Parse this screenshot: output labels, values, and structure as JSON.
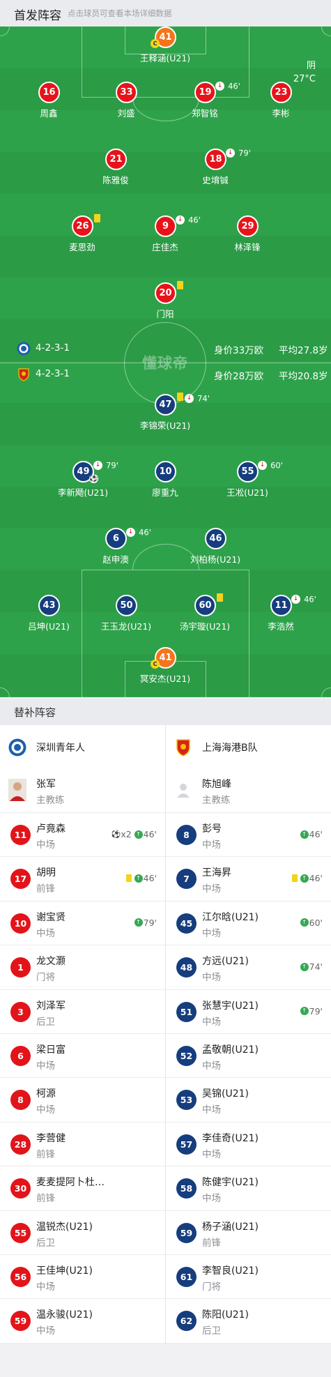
{
  "header": {
    "title": "首发阵容",
    "hint": "点击球员可查看本场详细数据"
  },
  "weather": {
    "condition": "阴",
    "temp": "27°C"
  },
  "watermark": "懂球帝",
  "home": {
    "formation": "4-2-3-1",
    "value": "身价33万欧",
    "avg_age": "平均27.8岁",
    "logo_icon": "shenzhen-youth-logo"
  },
  "away": {
    "formation": "4-2-3-1",
    "value": "身价28万欧",
    "avg_age": "平均20.8岁",
    "logo_icon": "shanghai-port-logo"
  },
  "home_players": [
    {
      "num": "41",
      "name": "王释涵(U21)",
      "captain": true
    },
    {
      "num": "16",
      "name": "周鑫"
    },
    {
      "num": "33",
      "name": "刘盛"
    },
    {
      "num": "19",
      "name": "郑智铭",
      "sub_min": "46'"
    },
    {
      "num": "23",
      "name": "李彬"
    },
    {
      "num": "21",
      "name": "陈雅俊"
    },
    {
      "num": "18",
      "name": "史堉铖",
      "sub_min": "79'"
    },
    {
      "num": "26",
      "name": "麦思劲",
      "yellow": true
    },
    {
      "num": "9",
      "name": "庄佳杰",
      "sub_min": "46'"
    },
    {
      "num": "29",
      "name": "林泽锋"
    },
    {
      "num": "20",
      "name": "门阳",
      "yellow": true
    }
  ],
  "away_players": [
    {
      "num": "47",
      "name": "李锦荣(U21)",
      "yellow": true,
      "sub_min": "74'"
    },
    {
      "num": "49",
      "name": "李新飏(U21)",
      "sub_min": "79'",
      "goal": true
    },
    {
      "num": "10",
      "name": "廖重九"
    },
    {
      "num": "55",
      "name": "王凇(U21)",
      "sub_min": "60'"
    },
    {
      "num": "6",
      "name": "赵申澳",
      "sub_min": "46'"
    },
    {
      "num": "46",
      "name": "刘柏杨(U21)"
    },
    {
      "num": "43",
      "name": "吕坤(U21)"
    },
    {
      "num": "50",
      "name": "王玉龙(U21)"
    },
    {
      "num": "60",
      "name": "汤宇璇(U21)",
      "yellow": true
    },
    {
      "num": "11",
      "name": "李浩然",
      "sub_min": "46'"
    },
    {
      "num": "41",
      "name": "冥安杰(U21)",
      "captain": true
    }
  ],
  "subs": {
    "title": "替补阵容",
    "home_team": "深圳青年人",
    "away_team": "上海海港B队",
    "home_coach": {
      "name": "张军",
      "role": "主教练"
    },
    "away_coach": {
      "name": "陈旭峰",
      "role": "主教练"
    },
    "home": [
      {
        "num": "11",
        "name": "卢竟森",
        "pos": "中场",
        "goals": "x2",
        "in": "46'"
      },
      {
        "num": "17",
        "name": "胡明",
        "pos": "前锋",
        "yellow": true,
        "in": "46'"
      },
      {
        "num": "10",
        "name": "谢宝贤",
        "pos": "中场",
        "in": "79'"
      },
      {
        "num": "1",
        "name": "龙文灏",
        "pos": "门将"
      },
      {
        "num": "3",
        "name": "刘泽军",
        "pos": "后卫"
      },
      {
        "num": "6",
        "name": "梁日富",
        "pos": "中场"
      },
      {
        "num": "8",
        "name": "柯源",
        "pos": "中场"
      },
      {
        "num": "28",
        "name": "李营健",
        "pos": "前锋"
      },
      {
        "num": "30",
        "name": "麦麦提阿卜杜…",
        "pos": "前锋"
      },
      {
        "num": "55",
        "name": "温锐杰(U21)",
        "pos": "后卫"
      },
      {
        "num": "56",
        "name": "王佳坤(U21)",
        "pos": "中场"
      },
      {
        "num": "59",
        "name": "温永骏(U21)",
        "pos": "中场"
      }
    ],
    "away": [
      {
        "num": "8",
        "name": "彭号",
        "pos": "中场",
        "in": "46'"
      },
      {
        "num": "7",
        "name": "王海昇",
        "pos": "中场",
        "yellow": true,
        "in": "46'"
      },
      {
        "num": "45",
        "name": "江尔晗(U21)",
        "pos": "中场",
        "in": "60'"
      },
      {
        "num": "48",
        "name": "方远(U21)",
        "pos": "中场",
        "in": "74'"
      },
      {
        "num": "51",
        "name": "张慧宇(U21)",
        "pos": "中场",
        "in": "79'"
      },
      {
        "num": "52",
        "name": "孟敬朝(U21)",
        "pos": "中场"
      },
      {
        "num": "53",
        "name": "吴锦(U21)",
        "pos": "中场"
      },
      {
        "num": "57",
        "name": "李佳奇(U21)",
        "pos": "中场"
      },
      {
        "num": "58",
        "name": "陈健宇(U21)",
        "pos": "中场"
      },
      {
        "num": "59",
        "name": "杨子涵(U21)",
        "pos": "前锋"
      },
      {
        "num": "61",
        "name": "李智良(U21)",
        "pos": "门将"
      },
      {
        "num": "62",
        "name": "陈阳(U21)",
        "pos": "后卫"
      }
    ]
  },
  "colors": {
    "pitch": "#2ea24a",
    "home": "#e8131a",
    "away": "#163d7e",
    "gk": "#f5741b"
  }
}
